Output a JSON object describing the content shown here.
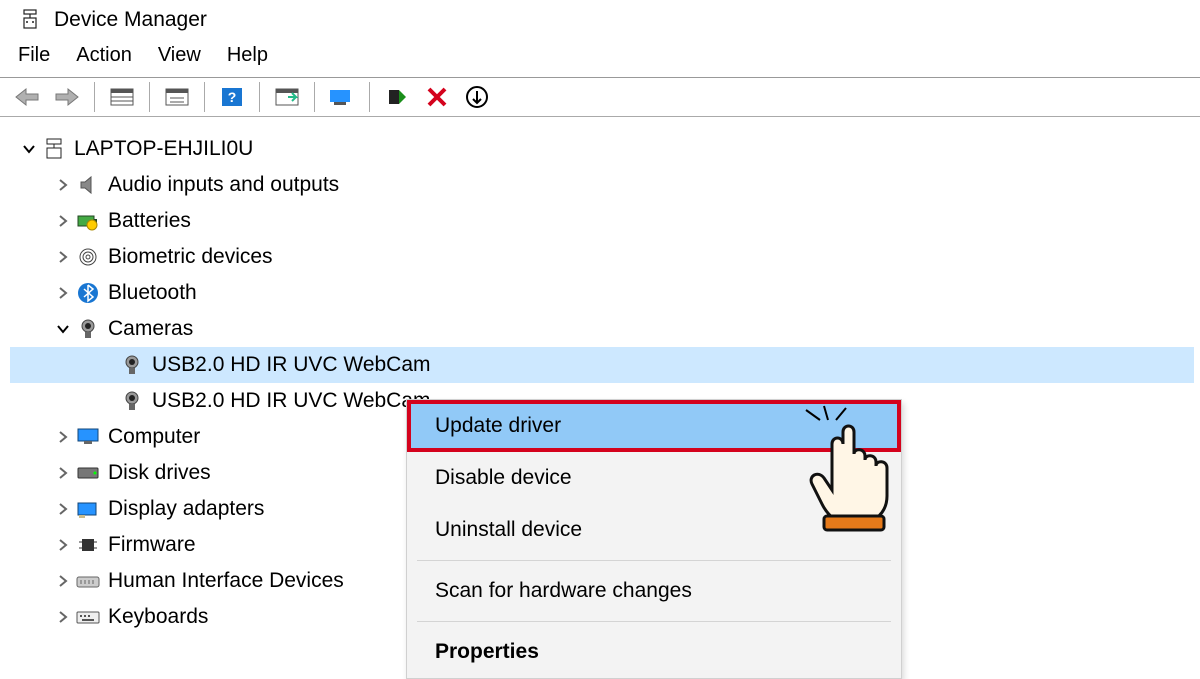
{
  "window": {
    "title": "Device Manager"
  },
  "menubar": [
    "File",
    "Action",
    "View",
    "Help"
  ],
  "tree": {
    "root": "LAPTOP-EHJILI0U",
    "nodes": [
      {
        "label": "Audio inputs and outputs",
        "icon": "speaker"
      },
      {
        "label": "Batteries",
        "icon": "battery"
      },
      {
        "label": "Biometric devices",
        "icon": "fingerprint"
      },
      {
        "label": "Bluetooth",
        "icon": "bluetooth"
      },
      {
        "label": "Cameras",
        "icon": "camera",
        "expanded": true,
        "children": [
          {
            "label": "USB2.0 HD IR UVC WebCam",
            "icon": "camera",
            "selected": true
          },
          {
            "label": "USB2.0 HD IR UVC WebCam",
            "icon": "camera"
          }
        ]
      },
      {
        "label": "Computer",
        "icon": "monitor"
      },
      {
        "label": "Disk drives",
        "icon": "disk"
      },
      {
        "label": "Display adapters",
        "icon": "display"
      },
      {
        "label": "Firmware",
        "icon": "chip"
      },
      {
        "label": "Human Interface Devices",
        "icon": "hid"
      },
      {
        "label": "Keyboards",
        "icon": "keyboard"
      }
    ]
  },
  "context_menu": {
    "items": [
      {
        "label": "Update driver",
        "highlighted": true
      },
      {
        "label": "Disable device"
      },
      {
        "label": "Uninstall device"
      },
      {
        "sep": true
      },
      {
        "label": "Scan for hardware changes"
      },
      {
        "sep": true
      },
      {
        "label": "Properties",
        "bold": true
      }
    ]
  }
}
